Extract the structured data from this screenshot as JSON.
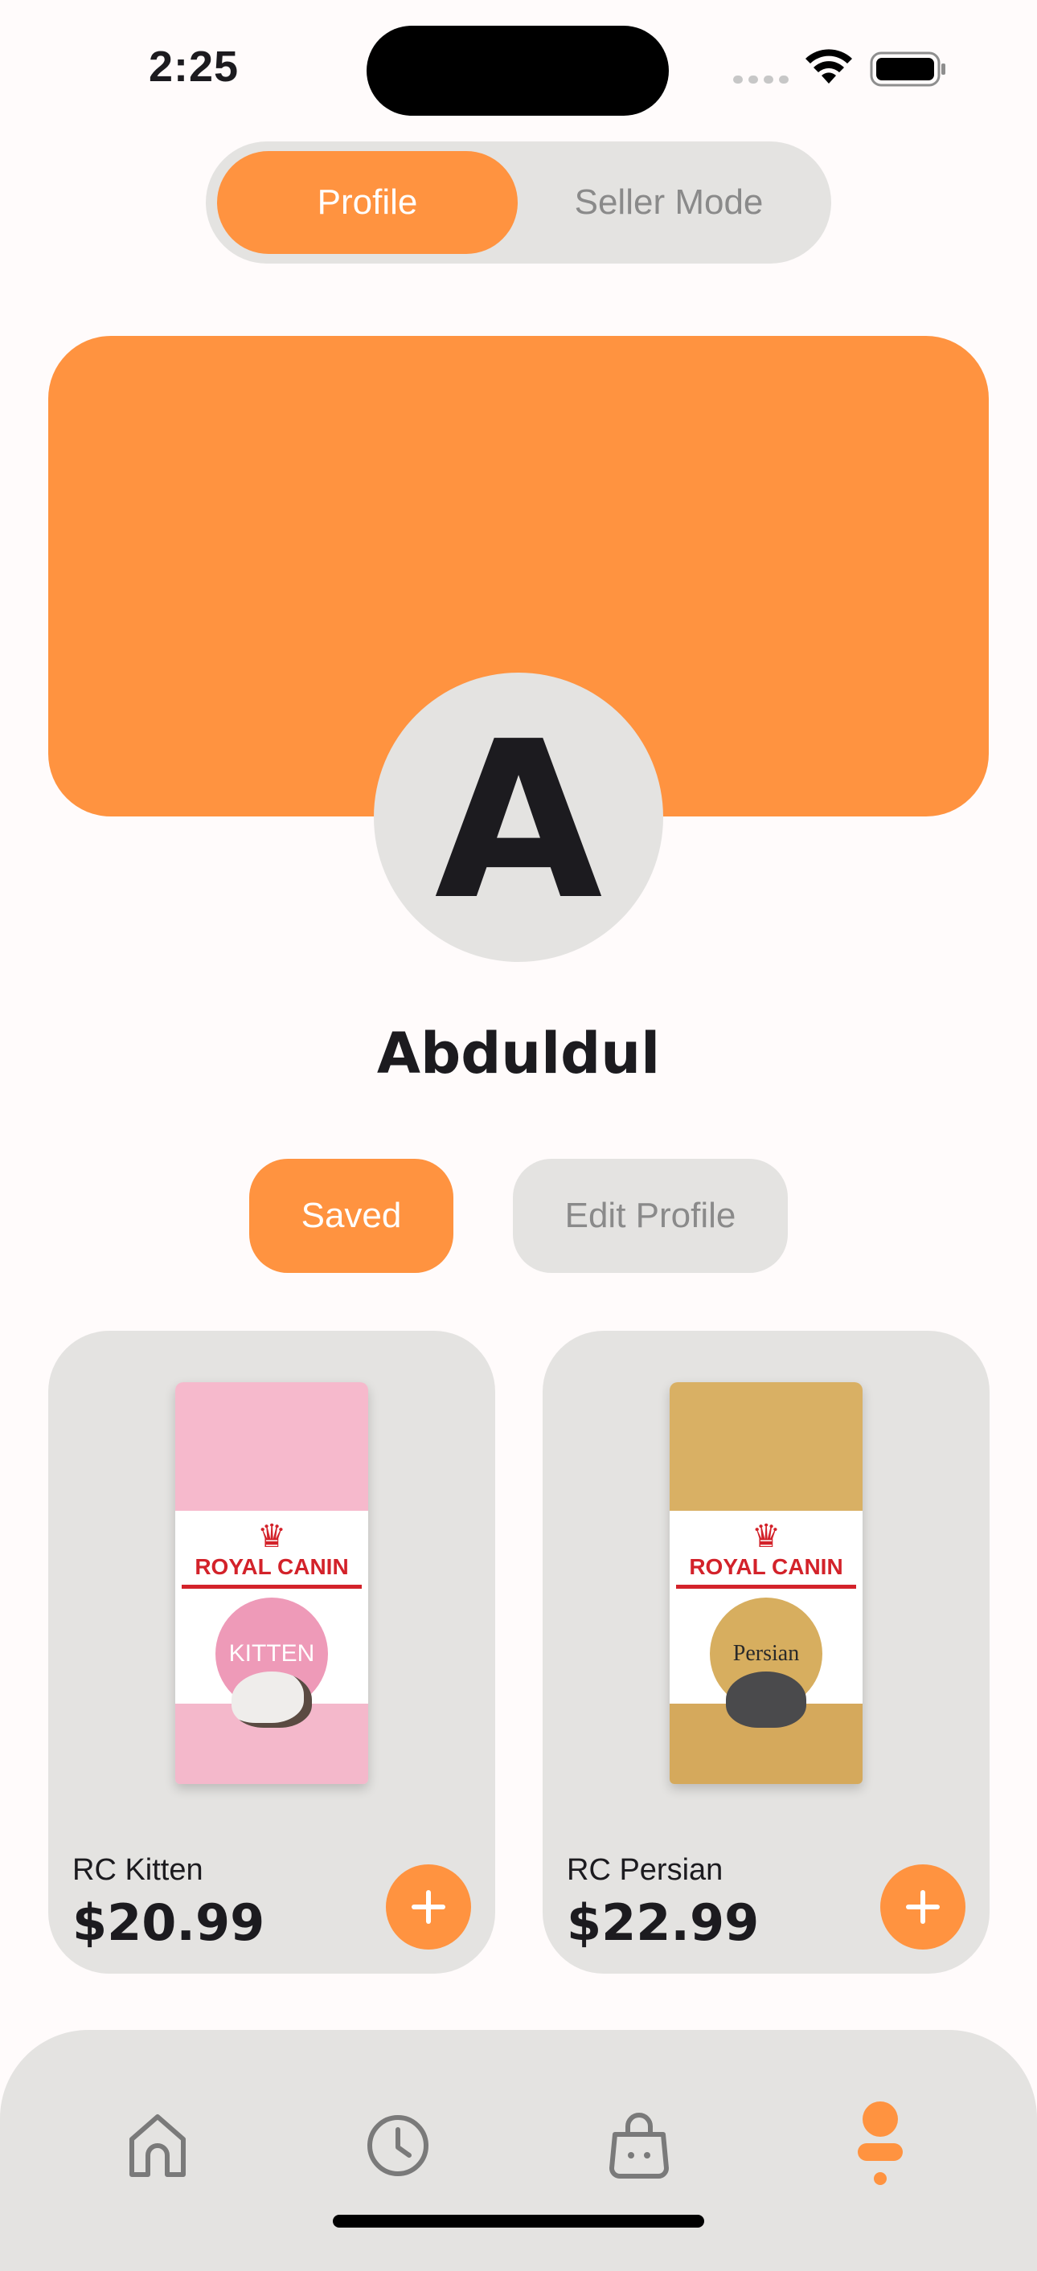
{
  "status_bar": {
    "time": "2:25",
    "icons": [
      "signal-icon",
      "wifi-icon",
      "battery-icon"
    ]
  },
  "mode_toggle": {
    "options": [
      "Profile",
      "Seller Mode"
    ],
    "selected": "Profile"
  },
  "profile": {
    "avatar_initial": "A",
    "username": "Abduldul"
  },
  "actions": {
    "saved_label": "Saved",
    "edit_label": "Edit Profile"
  },
  "products": [
    {
      "name": "RC Kitten",
      "price": "$20.99",
      "image": {
        "brand": "ROYAL CANIN",
        "variant": "KITTEN"
      }
    },
    {
      "name": "RC Persian",
      "price": "$22.99",
      "image": {
        "brand": "ROYAL CANIN",
        "variant": "Persian"
      }
    }
  ],
  "bottom_nav": {
    "items": [
      "home-icon",
      "history-icon",
      "cart-icon",
      "profile-icon"
    ],
    "active": "profile-icon"
  },
  "colors": {
    "accent": "#FF9340",
    "surface": "#E4E3E1",
    "background": "#FFFBFB",
    "text": "#1C1B1F",
    "muted_text": "#8A8A8A"
  }
}
